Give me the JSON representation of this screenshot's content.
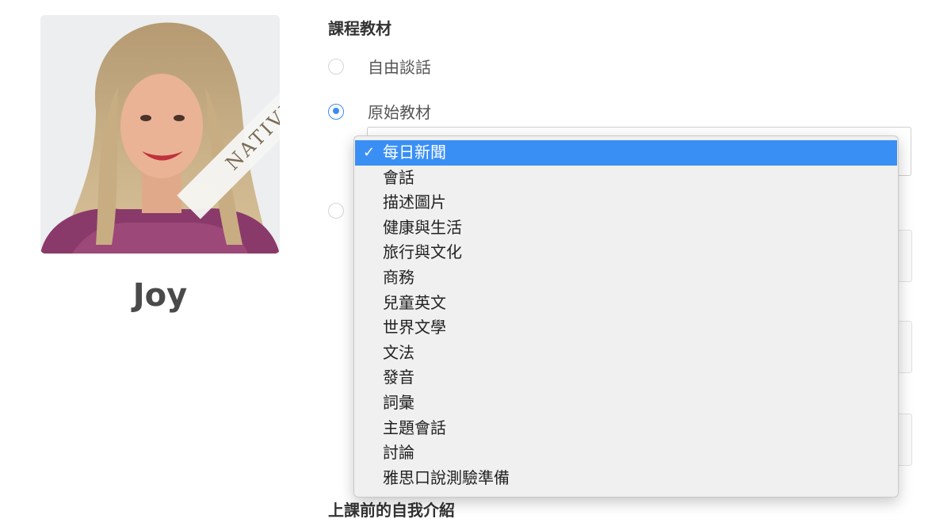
{
  "teacher": {
    "name": "Joy",
    "badge": "NATIVE"
  },
  "course_materials": {
    "heading": "課程教材",
    "options": [
      {
        "label": "自由談話",
        "selected": false
      },
      {
        "label": "原始教材",
        "selected": true
      }
    ],
    "dropdown": {
      "selected_index": 0,
      "items": [
        "每日新聞",
        "會話",
        "描述圖片",
        "健康與生活",
        "旅行與文化",
        "商務",
        "兒童英文",
        "世界文學",
        "文法",
        "發音",
        "詞彙",
        "主題會話",
        "討論",
        "雅思口說測驗準備"
      ]
    }
  },
  "self_intro": {
    "heading": "上課前的自我介紹"
  },
  "colors": {
    "accent": "#3b8ef0",
    "highlight": "#3a8ff5",
    "menu_bg": "#f0f0f0"
  }
}
